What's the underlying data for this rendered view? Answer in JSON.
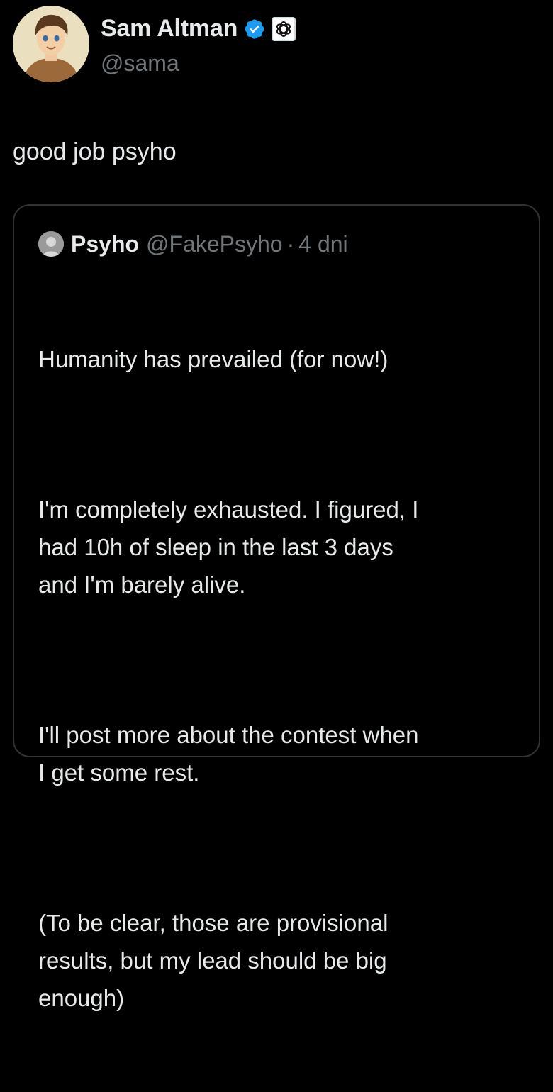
{
  "tweet": {
    "author": {
      "display_name": "Sam Altman",
      "handle": "@sama",
      "verified_icon": "verified-badge-icon",
      "affiliation_icon": "openai-logo-icon"
    },
    "text": "good job psyho"
  },
  "quoted_tweet": {
    "author": {
      "display_name": "Psyho",
      "handle": "@FakePsyho"
    },
    "separator": "·",
    "time": "4 dni",
    "paragraphs": [
      "Humanity has prevailed (for now!)",
      "I'm completely exhausted. I figured, I\nhad 10h of sleep in the last 3 days\nand I'm barely alive.",
      "I'll post more about the contest when\nI get some rest.",
      "(To be clear, those are provisional\nresults, but my lead should be big\nenough)"
    ]
  },
  "colors": {
    "background": "#000000",
    "primary_text": "#e7e9ea",
    "secondary_text": "#71767b",
    "verified_blue": "#1d9bf0",
    "card_border": "#2f3336"
  }
}
